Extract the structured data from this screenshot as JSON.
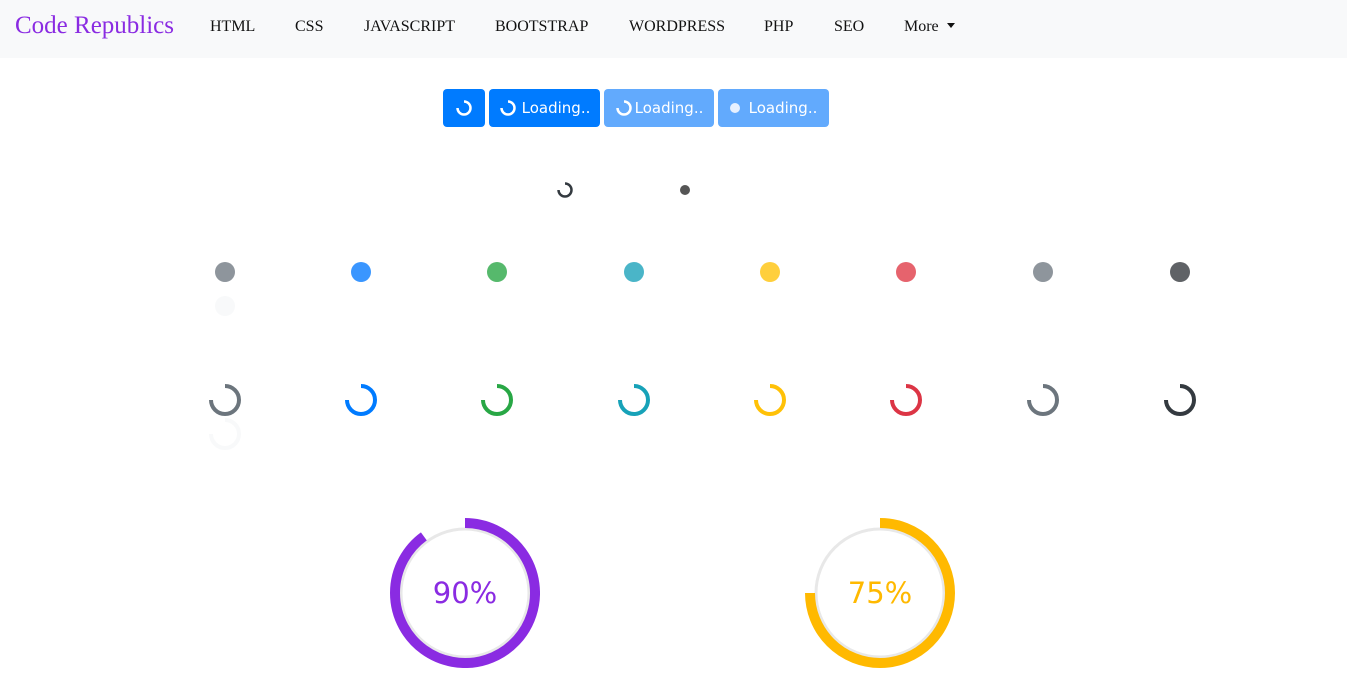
{
  "navbar": {
    "brand": "Code Republics",
    "brand_color": "#8a2be2",
    "items": [
      {
        "label": "HTML"
      },
      {
        "label": "CSS"
      },
      {
        "label": "JAVASCRIPT"
      },
      {
        "label": "BOOTSTRAP"
      },
      {
        "label": "WORDPRESS"
      },
      {
        "label": "PHP"
      },
      {
        "label": "SEO"
      },
      {
        "label": "More",
        "dropdown": true,
        "icon": "caret-down-icon"
      }
    ]
  },
  "buttons": [
    {
      "label": "",
      "icon": "spinner-border-icon",
      "state": "enabled"
    },
    {
      "label": "Loading..",
      "icon": "spinner-border-icon",
      "state": "enabled"
    },
    {
      "label": "Loading..",
      "icon": "spinner-border-icon",
      "state": "disabled"
    },
    {
      "label": "Loading..",
      "icon": "spinner-grow-icon",
      "state": "disabled"
    }
  ],
  "standalone_spinners": [
    {
      "type": "border",
      "color": "#343a40"
    },
    {
      "type": "grow",
      "color": "#555555"
    }
  ],
  "grow_spinners": {
    "colors": [
      "#8e959c",
      "#3a96ff",
      "#56b96c",
      "#4ab5c8",
      "#ffcf3c",
      "#e6636d",
      "#8e959c",
      "#5f6266",
      "#f8f9fa"
    ],
    "names": [
      "secondary",
      "primary",
      "success",
      "info",
      "warning",
      "danger",
      "secondary",
      "dark",
      "light"
    ]
  },
  "border_spinners": {
    "colors": [
      "#6c757d",
      "#007bff",
      "#28a745",
      "#17a2b8",
      "#ffc107",
      "#dc3545",
      "#6c757d",
      "#343a40",
      "#f8f9fa"
    ],
    "names": [
      "secondary",
      "primary",
      "success",
      "info",
      "warning",
      "danger",
      "secondary",
      "dark",
      "light"
    ]
  },
  "progress_circles": [
    {
      "value": 90,
      "label": "90%",
      "color": "#8a2be2"
    },
    {
      "value": 75,
      "label": "75%",
      "color": "#ffb900"
    }
  ]
}
